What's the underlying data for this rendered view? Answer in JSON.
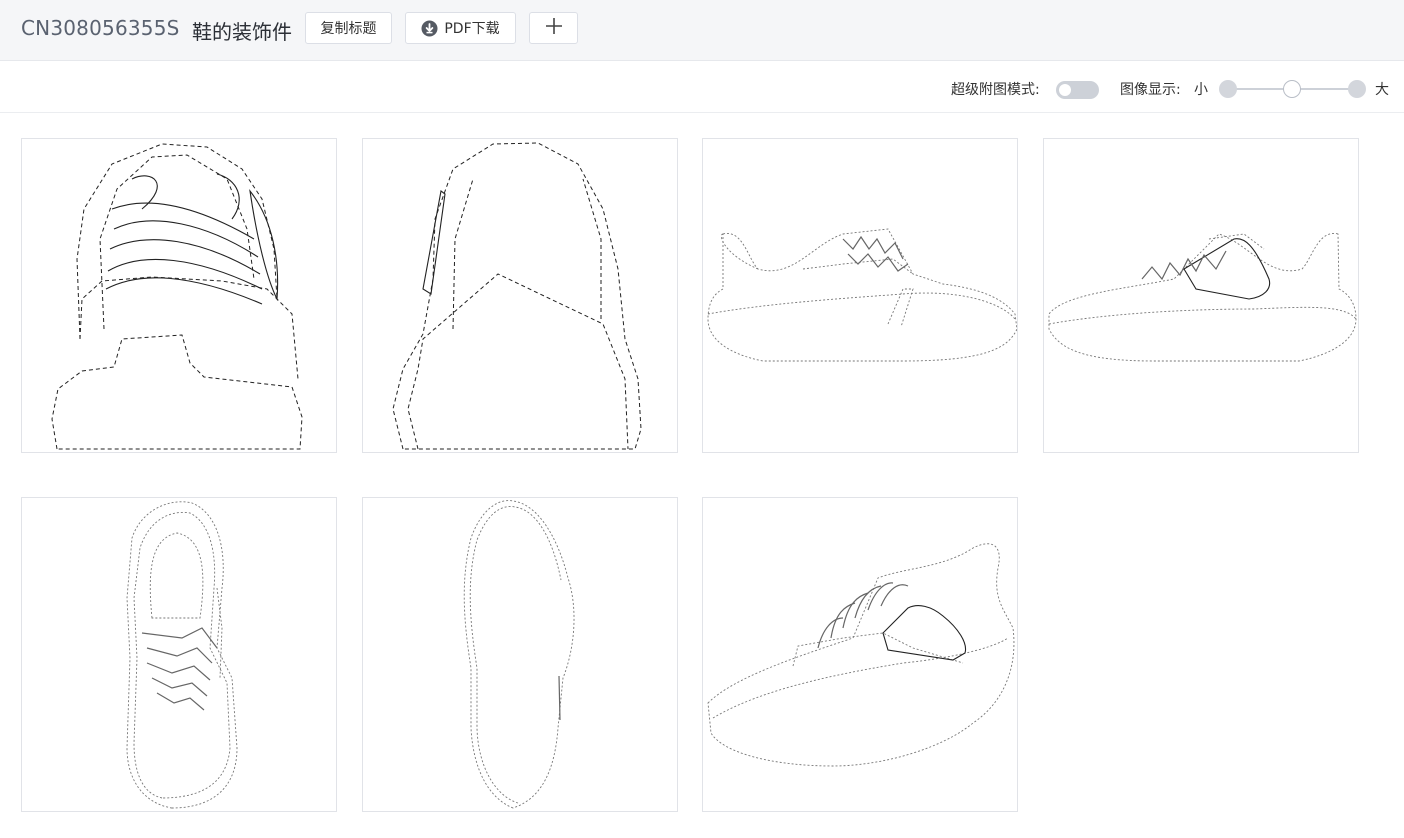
{
  "header": {
    "publication_number": "CN308056355S",
    "title": "鞋的装饰件",
    "copy_title_label": "复制标题",
    "pdf_download_label": "PDF下载",
    "add_icon": "plus-icon",
    "download_icon": "download-circle-icon"
  },
  "toolbar": {
    "super_figure_mode_label": "超级附图模式:",
    "super_figure_mode_enabled": false,
    "image_display_label": "图像显示:",
    "size_small_label": "小",
    "size_large_label": "大",
    "size_level": "medium"
  },
  "gallery": {
    "figure_count": 7
  }
}
